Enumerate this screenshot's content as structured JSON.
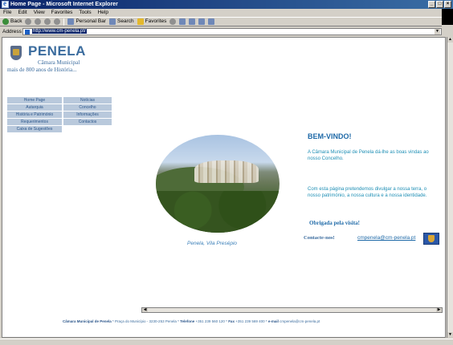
{
  "window": {
    "title": "Home Page - Microsoft Internet Explorer"
  },
  "menubar": {
    "items": [
      "File",
      "Edit",
      "View",
      "Favorites",
      "Tools",
      "Help"
    ]
  },
  "toolbar": {
    "back": "Back",
    "personal_bar": "Personal Bar",
    "search": "Search",
    "favorites": "Favorites"
  },
  "address": {
    "label": "Address",
    "url": "http://www.cm-penela.pt/"
  },
  "site": {
    "name": "PENELA",
    "subtitle": "Câmara Municipal",
    "tagline": "mais de 800 anos de História..."
  },
  "nav": [
    "Home Page",
    "Notícias",
    "Autarquia",
    "Concelho",
    "História e Património",
    "Informações",
    "Requerimentos",
    "Contactos",
    "Caixa de Sugestões"
  ],
  "photo": {
    "caption": "Penela, Vila Presépio"
  },
  "welcome": {
    "heading": "BEM-VINDO!",
    "intro": "A Câmara Municipal de Penela dá-lhe as boas vindas ao nosso Concelho.",
    "purpose": "Com esta página pretendemos divulgar a nossa terra, o nosso património, a nossa cultura e a nossa identidade.",
    "thanks": "Obrigada pela visita!"
  },
  "contact": {
    "label": "Contacte-nos!",
    "email": "cmpenela@cm-penela.pt"
  },
  "footer": {
    "org": "Câmara Municipal de Penela",
    "address": " * Praça do Município - 3230-253 Penela * ",
    "phone_label": "Telefone",
    "phone": " +351 239 560 120 * ",
    "fax_label": "Fax",
    "fax": " +351 239 569 400 * ",
    "email_label": "e-mail",
    "email": " cmpenela@cm-penela.pt"
  }
}
